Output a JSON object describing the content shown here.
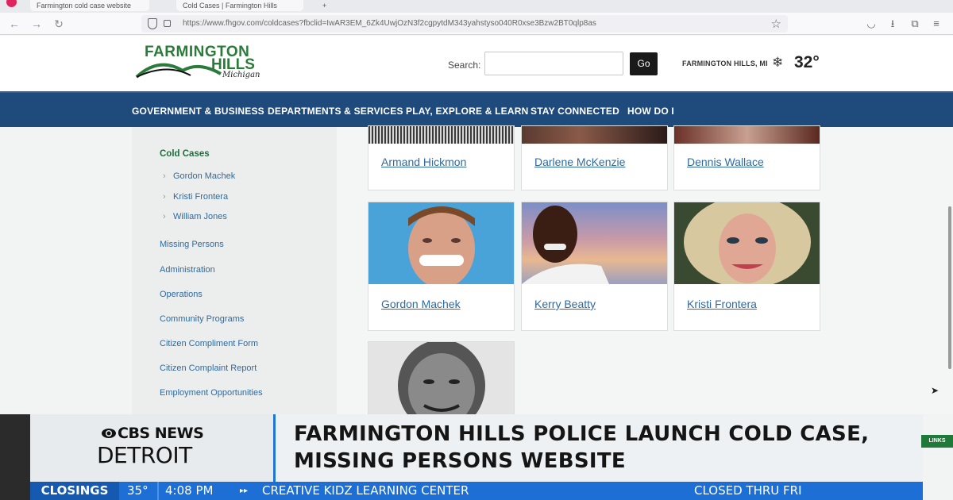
{
  "browser": {
    "tabs": [
      {
        "label": "Farmington cold case website"
      },
      {
        "label": "Cold Cases | Farmington Hills"
      }
    ],
    "url": "https://www.fhgov.com/coldcases?fbclid=IwAR3EM_6Zk4UwjOzN3f2cgpytdM343yahstyso040R0xse3Bzw2BT0qlp8as"
  },
  "site": {
    "logo": {
      "line1": "FARMINGTON",
      "line2": "HILLS",
      "line3": "Michigan"
    },
    "search_label": "Search:",
    "search_placeholder": "",
    "go_label": "Go",
    "location": "FARMINGTON HILLS, MI",
    "temperature": "32°",
    "nav": [
      "GOVERNMENT & BUSINESS",
      "DEPARTMENTS & SERVICES",
      "PLAY, EXPLORE & LEARN",
      "STAY CONNECTED",
      "HOW DO I"
    ]
  },
  "sidebar": {
    "active": "Cold Cases",
    "subitems": [
      "Gordon Machek",
      "Kristi Frontera",
      "William Jones"
    ],
    "items": [
      "Missing Persons",
      "Administration",
      "Operations",
      "Community Programs",
      "Citizen Compliment Form",
      "Citizen Complaint Report",
      "Employment Opportunities"
    ]
  },
  "cards": {
    "row1": [
      "Armand Hickmon",
      "Darlene McKenzie",
      "Dennis Wallace"
    ],
    "row2": [
      "Gordon Machek",
      "Kerry Beatty",
      "Kristi Frontera"
    ]
  },
  "broadcast": {
    "network": "CBS NEWS",
    "station": "DETROIT",
    "headline_line1": "FARMINGTON HILLS POLICE LAUNCH COLD CASE,",
    "headline_line2": "MISSING PERSONS WEBSITE",
    "side_tag": "LINKS",
    "ticker": {
      "label": "CLOSINGS",
      "temp": "35°",
      "time": "4:08 PM",
      "business": "CREATIVE KIDZ LEARNING CENTER",
      "status": "CLOSED THRU FRI"
    }
  }
}
